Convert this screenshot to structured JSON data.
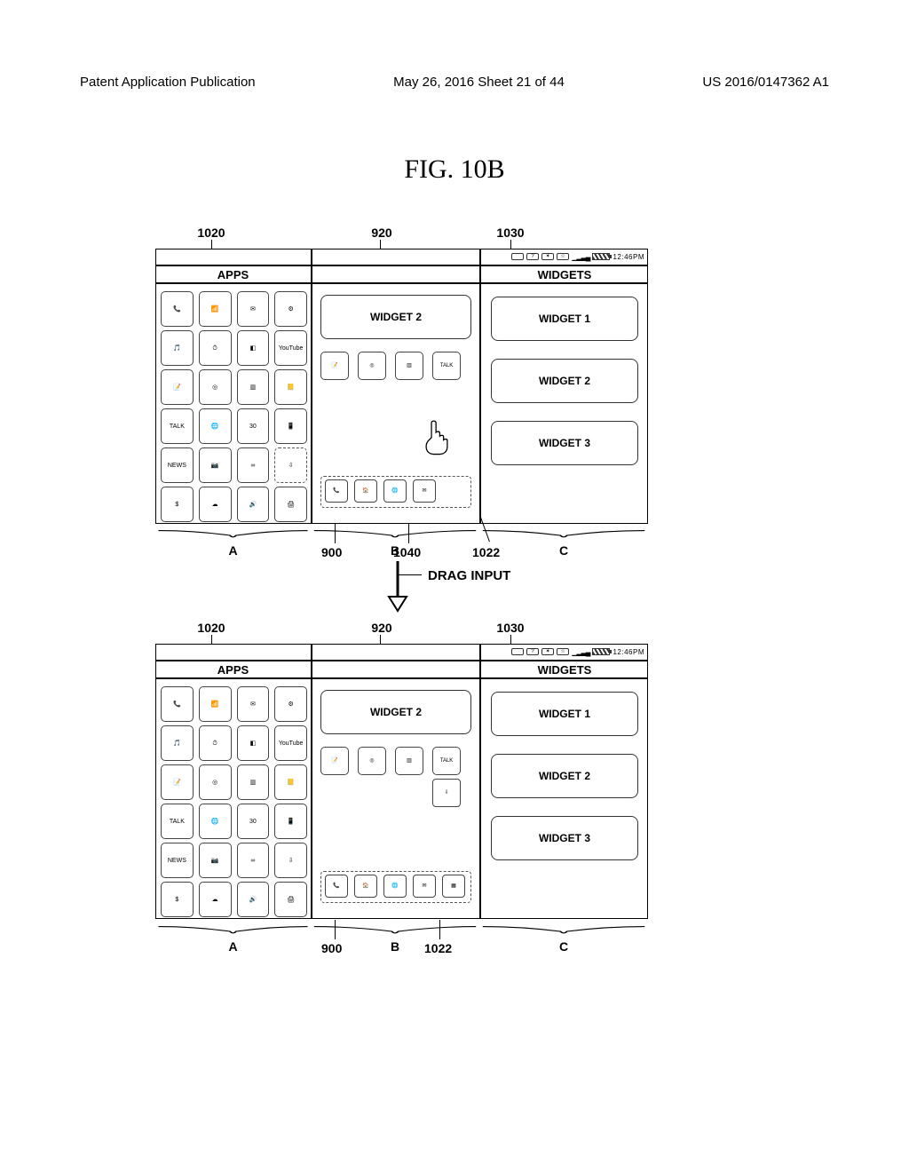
{
  "header": {
    "left": "Patent Application Publication",
    "center": "May 26, 2016  Sheet 21 of 44",
    "right": "US 2016/0147362 A1"
  },
  "figure_title": "FIG. 10B",
  "status_time": "12:46PM",
  "panels": {
    "A_title": "APPS",
    "C_title": "WIDGETS",
    "B_widget_label": "WIDGET 2",
    "C_widgets": [
      "WIDGET 1",
      "WIDGET 2",
      "WIDGET 3"
    ]
  },
  "panelA_icons": [
    "📞",
    "📶",
    "✉︎",
    "⚙︎",
    "🎵",
    "⏱",
    "◧",
    "YouTube",
    "📝",
    "◎",
    "▥",
    "📒",
    "TALK",
    "🌐",
    "30",
    "📱",
    "NEWS",
    "📷",
    "∞",
    "⇩",
    "$",
    "☁",
    "🔊",
    "🖨"
  ],
  "panelB_icons_row": [
    "📝",
    "◎",
    "▥",
    "TALK"
  ],
  "panelB_dock": [
    "📞",
    "🏠",
    "🌐",
    "✉︎",
    "▦"
  ],
  "special": {
    "dashed_touch_glyph": "⇩",
    "placed_app_glyph": "▦"
  },
  "callouts_top": {
    "c1020": "1020",
    "c920": "920",
    "c1030": "1030",
    "c900": "900",
    "c1040": "1040",
    "c1022": "1022",
    "A": "A",
    "B": "B",
    "C": "C"
  },
  "callouts_bottom": {
    "c1020": "1020",
    "c920": "920",
    "c1030": "1030",
    "c900": "900",
    "c1022": "1022",
    "A": "A",
    "B": "B",
    "C": "C"
  },
  "drag_label": "DRAG INPUT"
}
